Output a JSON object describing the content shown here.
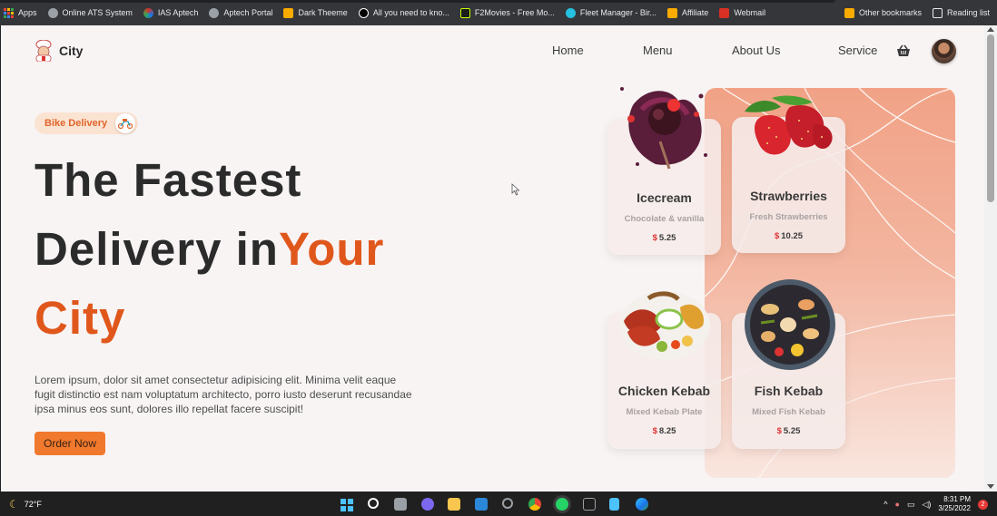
{
  "bookmarks": {
    "items": [
      {
        "label": "Apps",
        "color": "#4285f4"
      },
      {
        "label": "Online ATS System",
        "color": "#9aa0a6"
      },
      {
        "label": "IAS Aptech",
        "color": "#d93025"
      },
      {
        "label": "Aptech Portal",
        "color": "#9aa0a6"
      },
      {
        "label": "Dark Theeme",
        "color": "#f9ab00"
      },
      {
        "label": "All you need to kno...",
        "color": "#000000"
      },
      {
        "label": "F2Movies - Free Mo...",
        "color": "#c6ff00"
      },
      {
        "label": "Fleet Manager - Bir...",
        "color": "#24c1e0"
      },
      {
        "label": "Affiliate",
        "color": "#f9ab00"
      },
      {
        "label": "Webmail",
        "color": "#d93025"
      }
    ],
    "other": "Other bookmarks",
    "reading": "Reading list"
  },
  "site": {
    "logo_text": "City",
    "nav": {
      "home": "Home",
      "menu": "Menu",
      "about": "About Us",
      "service": "Service"
    },
    "pill": "Bike Delivery",
    "headline": {
      "line1": "The Fastest",
      "line2a": "Delivery in",
      "line2b": "Your",
      "line3": "City"
    },
    "description": "Lorem ipsum, dolor sit amet consectetur adipisicing elit. Minima velit eaque fugit distinctio est nam voluptatum architecto, porro iusto deserunt recusandae ipsa minus eos sunt, dolores illo repellat facere suscipit!",
    "order_button": "Order Now",
    "accent_color": "#e0571c",
    "button_color": "#f0792d"
  },
  "cards": [
    {
      "name": "Icecream",
      "sub": "Chocolate & vanilla",
      "currency": "$",
      "price": "5.25",
      "image": "icecream-image"
    },
    {
      "name": "Strawberries",
      "sub": "Fresh Strawberries",
      "currency": "$",
      "price": "10.25",
      "image": "strawberries-image"
    },
    {
      "name": "Chicken Kebab",
      "sub": "Mixed Kebab Plate",
      "currency": "$",
      "price": "8.25",
      "image": "chicken-kebab-image"
    },
    {
      "name": "Fish Kebab",
      "sub": "Mixed Fish Kebab",
      "currency": "$",
      "price": "5.25",
      "image": "fish-kebab-image"
    }
  ],
  "taskbar": {
    "weather": "72°F",
    "time": "8:31 PM",
    "date": "3/25/2022",
    "notifications": "2"
  }
}
